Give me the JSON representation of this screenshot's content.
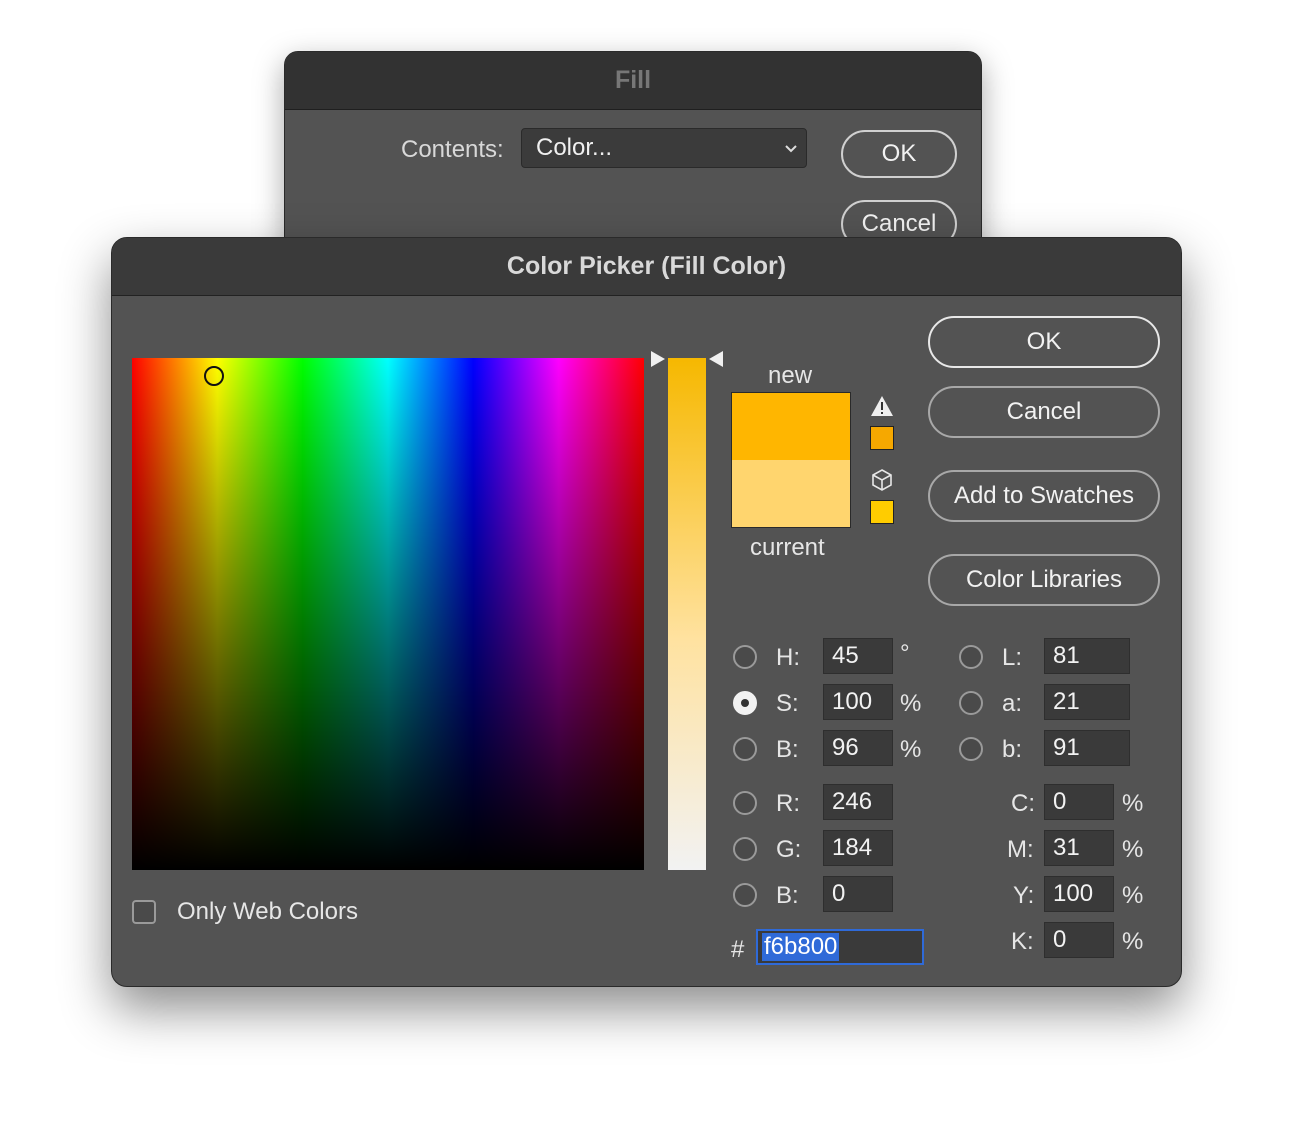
{
  "fill_dialog": {
    "title": "Fill",
    "contents_label": "Contents:",
    "contents_value": "Color...",
    "ok_label": "OK",
    "cancel_label": "Cancel"
  },
  "picker": {
    "title": "Color Picker (Fill Color)",
    "new_label": "new",
    "current_label": "current",
    "new_color": "#ffb600",
    "current_color": "#ffd56e",
    "gamut_warning_color": "#f6a800",
    "web_safe_color": "#ffcc00",
    "buttons": {
      "ok": "OK",
      "cancel": "Cancel",
      "add_to_swatches": "Add to Swatches",
      "color_libraries": "Color Libraries"
    },
    "hsb": {
      "h_label": "H:",
      "h_value": "45",
      "h_unit": "°",
      "s_label": "S:",
      "s_value": "100",
      "s_unit": "%",
      "b_label": "B:",
      "b_value": "96",
      "b_unit": "%"
    },
    "rgb": {
      "r_label": "R:",
      "r_value": "246",
      "g_label": "G:",
      "g_value": "184",
      "b_label": "B:",
      "b_value": "0"
    },
    "lab": {
      "l_label": "L:",
      "l_value": "81",
      "a_label": "a:",
      "a_value": "21",
      "b_label": "b:",
      "b_value": "91"
    },
    "cmyk": {
      "c_label": "C:",
      "c_value": "0",
      "m_label": "M:",
      "m_value": "31",
      "y_label": "Y:",
      "y_value": "100",
      "k_label": "K:",
      "k_value": "0",
      "unit": "%"
    },
    "hex_symbol": "#",
    "hex_value": "f6b800",
    "selected_mode": "S",
    "only_web_colors_label": "Only Web Colors",
    "only_web_colors_checked": false
  }
}
